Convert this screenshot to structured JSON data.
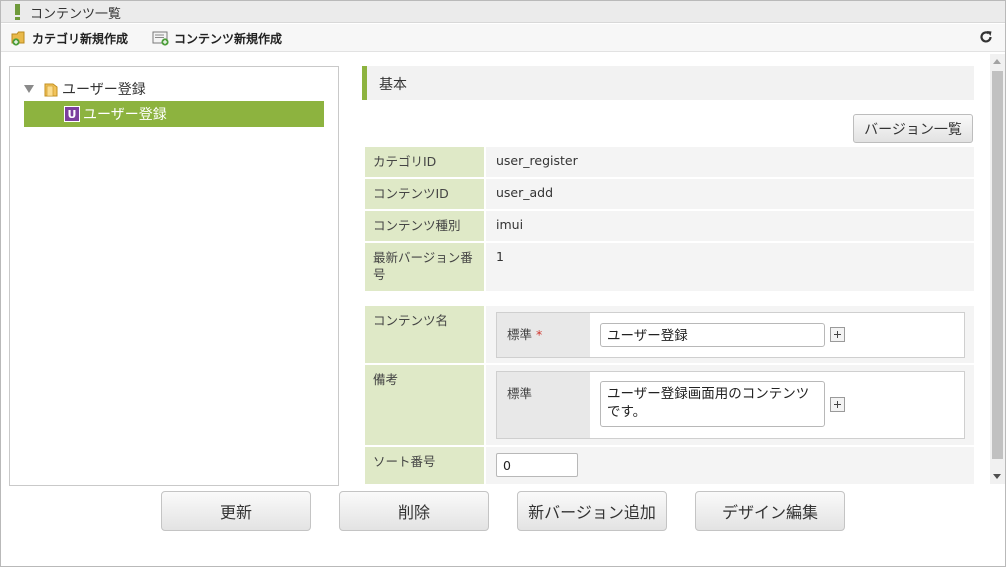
{
  "window": {
    "title": "コンテンツ一覧"
  },
  "toolbar": {
    "new_category_label": "カテゴリ新規作成",
    "new_content_label": "コンテンツ新規作成"
  },
  "tree": {
    "root_label": "ユーザー登録",
    "child_label": "ユーザー登録",
    "child_icon_letter": "U"
  },
  "detail": {
    "section_title": "基本",
    "version_list_label": "バージョン一覧",
    "fields": {
      "category_id": {
        "label": "カテゴリID",
        "value": "user_register"
      },
      "content_id": {
        "label": "コンテンツID",
        "value": "user_add"
      },
      "content_type": {
        "label": "コンテンツ種別",
        "value": "imui"
      },
      "latest_version": {
        "label": "最新バージョン番号",
        "value": "1"
      }
    },
    "content_name": {
      "label": "コンテンツ名",
      "sub_label": "標準",
      "required_mark": "*",
      "value": "ユーザー登録"
    },
    "remarks": {
      "label": "備考",
      "sub_label": "標準",
      "value": "ユーザー登録画面用のコンテンツです。"
    },
    "sort_order": {
      "label": "ソート番号",
      "value": "0"
    }
  },
  "buttons": {
    "update": "更新",
    "delete": "削除",
    "add_version": "新バージョン追加",
    "design_edit": "デザイン編集"
  },
  "colors": {
    "accent_green": "#8db33f",
    "label_bg": "#dfe9c7",
    "icon_purple": "#7c3f9e"
  }
}
